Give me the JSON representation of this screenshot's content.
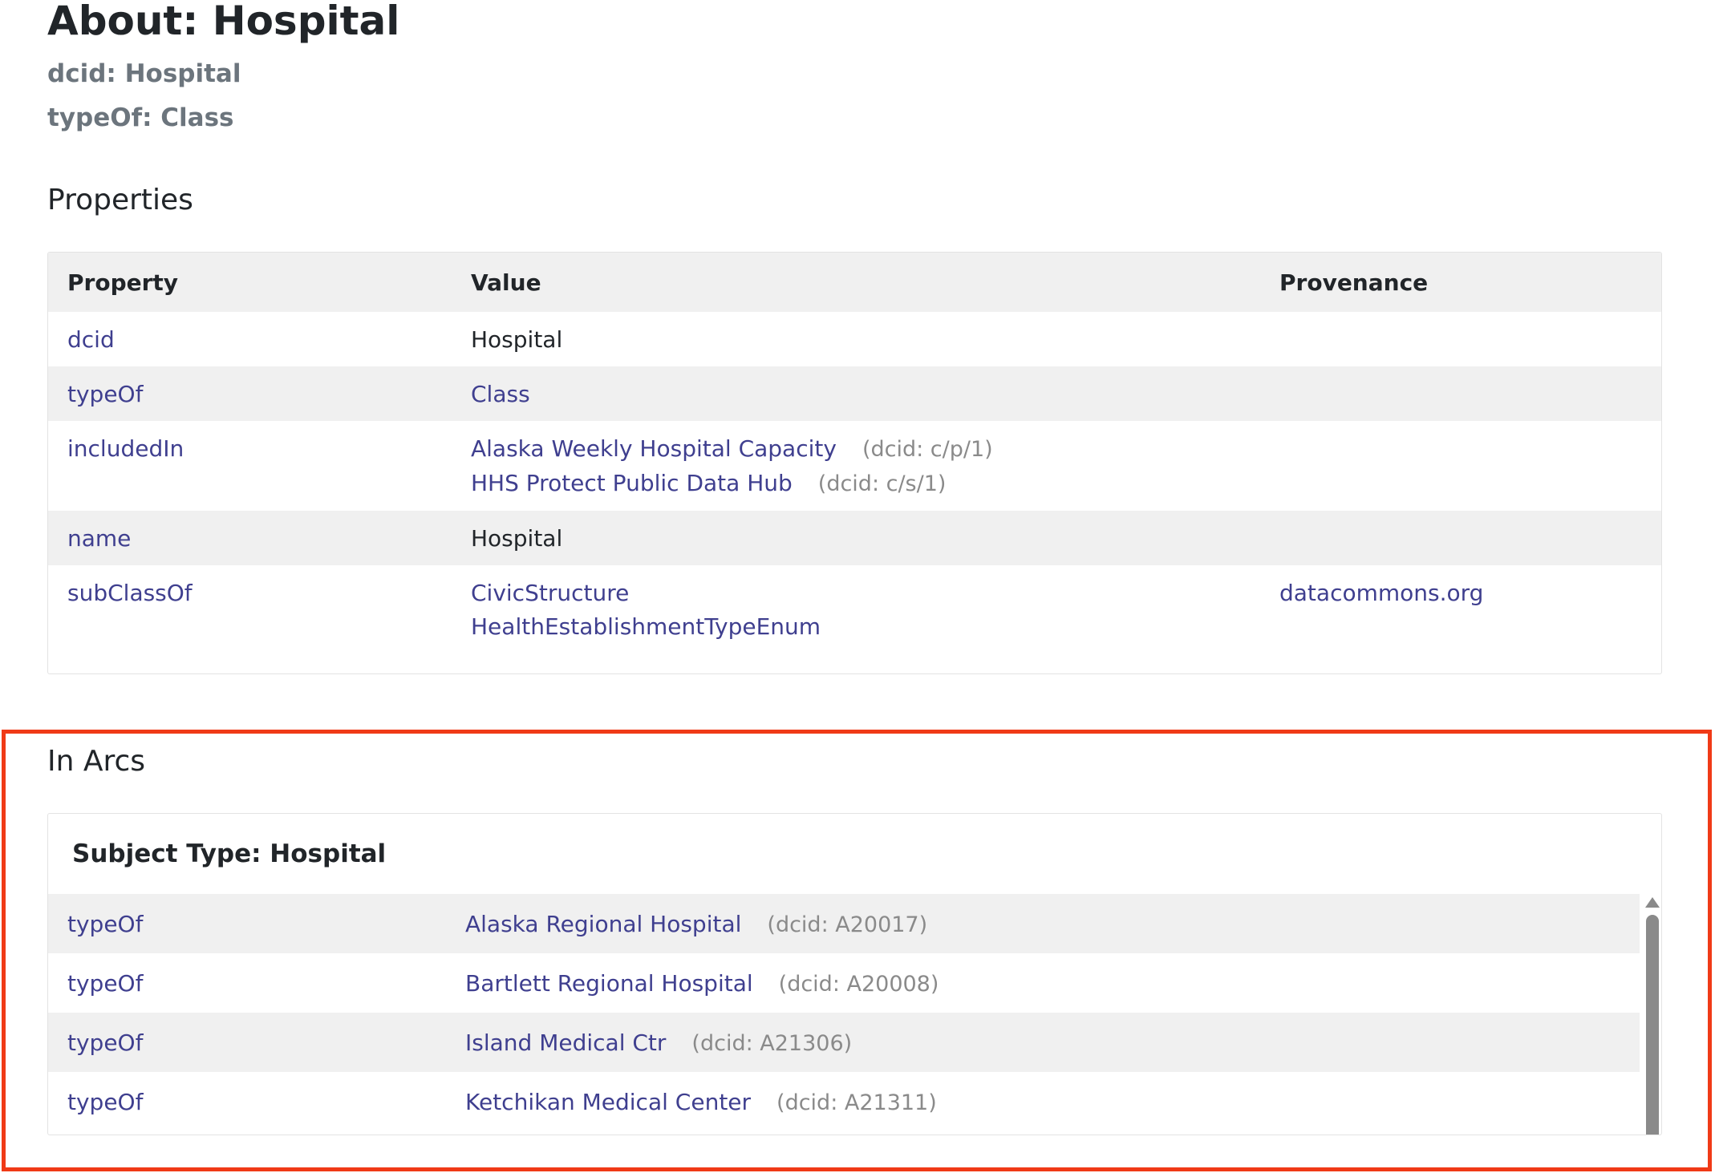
{
  "header": {
    "title": "About: Hospital",
    "dcid_line": "dcid: Hospital",
    "typeof_line": "typeOf: Class"
  },
  "properties": {
    "heading": "Properties",
    "columns": [
      "Property",
      "Value",
      "Provenance"
    ],
    "rows": [
      {
        "property": "dcid",
        "values": [
          {
            "text": "Hospital",
            "dcid": "",
            "link": false
          }
        ],
        "provenance": ""
      },
      {
        "property": "typeOf",
        "values": [
          {
            "text": "Class",
            "dcid": "",
            "link": true
          }
        ],
        "provenance": ""
      },
      {
        "property": "includedIn",
        "values": [
          {
            "text": "Alaska Weekly Hospital Capacity",
            "dcid": "(dcid: c/p/1)",
            "link": true
          },
          {
            "text": "HHS Protect Public Data Hub",
            "dcid": "(dcid: c/s/1)",
            "link": true
          }
        ],
        "provenance": ""
      },
      {
        "property": "name",
        "values": [
          {
            "text": "Hospital",
            "dcid": "",
            "link": false
          }
        ],
        "provenance": ""
      },
      {
        "property": "subClassOf",
        "values": [
          {
            "text": "CivicStructure",
            "dcid": "",
            "link": true
          },
          {
            "text": "HealthEstablishmentTypeEnum",
            "dcid": "",
            "link": true
          }
        ],
        "provenance": "datacommons.org"
      }
    ]
  },
  "in_arcs": {
    "heading": "In Arcs",
    "subject_type": "Subject Type: Hospital",
    "rows": [
      {
        "property": "typeOf",
        "name": "Alaska Regional Hospital",
        "dcid": "(dcid: A20017)"
      },
      {
        "property": "typeOf",
        "name": "Bartlett Regional Hospital",
        "dcid": "(dcid: A20008)"
      },
      {
        "property": "typeOf",
        "name": "Island Medical Ctr",
        "dcid": "(dcid: A21306)"
      },
      {
        "property": "typeOf",
        "name": "Ketchikan Medical Center",
        "dcid": "(dcid: A21311)"
      }
    ]
  },
  "colors": {
    "link": "#3f3f8f",
    "muted": "#8a8a8a",
    "row_shade": "#f0f0f0",
    "highlight": "#f03a17"
  }
}
